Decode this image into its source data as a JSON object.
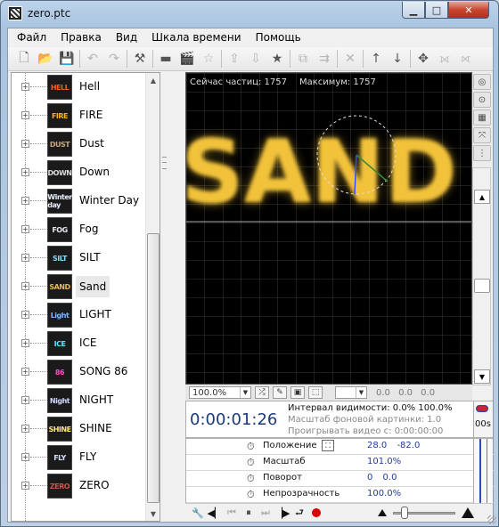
{
  "window": {
    "title": "zero.ptc",
    "min_glyph": "▁",
    "max_glyph": "□",
    "close_glyph": "✕"
  },
  "menu": [
    "Файл",
    "Правка",
    "Вид",
    "Шкала времени",
    "Помощь"
  ],
  "toolbar": [
    {
      "icon": "new-file-icon",
      "glyph": "🗋",
      "enabled": true
    },
    {
      "icon": "open-folder-icon",
      "glyph": "📂",
      "enabled": true
    },
    {
      "icon": "save-icon",
      "glyph": "💾",
      "enabled": false
    },
    {
      "sep": true
    },
    {
      "icon": "undo-icon",
      "glyph": "↶",
      "enabled": false
    },
    {
      "icon": "redo-icon",
      "glyph": "↷",
      "enabled": false
    },
    {
      "sep": true
    },
    {
      "icon": "wand-icon",
      "glyph": "⚒",
      "enabled": true
    },
    {
      "sep": true
    },
    {
      "icon": "folder-icon",
      "glyph": "▬",
      "enabled": true
    },
    {
      "icon": "clapper-icon",
      "glyph": "🎬",
      "enabled": true
    },
    {
      "icon": "star-icon",
      "glyph": "☆",
      "enabled": false
    },
    {
      "sep": true
    },
    {
      "icon": "export-icon",
      "glyph": "⇪",
      "enabled": false
    },
    {
      "icon": "import-icon",
      "glyph": "⇩",
      "enabled": false
    },
    {
      "icon": "add-star-icon",
      "glyph": "★",
      "enabled": true
    },
    {
      "sep": true
    },
    {
      "icon": "copy-icon",
      "glyph": "⧉",
      "enabled": false
    },
    {
      "icon": "move-icon",
      "glyph": "⇉",
      "enabled": false
    },
    {
      "sep": true
    },
    {
      "icon": "delete-icon",
      "glyph": "✕",
      "enabled": false
    },
    {
      "sep": true
    },
    {
      "icon": "arrow-up-icon",
      "glyph": "↑",
      "enabled": true
    },
    {
      "icon": "arrow-down-icon",
      "glyph": "↓",
      "enabled": true
    },
    {
      "sep": true
    },
    {
      "icon": "move-all-icon",
      "glyph": "✥",
      "enabled": true
    },
    {
      "icon": "link-icon",
      "glyph": "⟗",
      "enabled": false
    },
    {
      "icon": "unlink-icon",
      "glyph": "⟖",
      "enabled": false
    }
  ],
  "effects": [
    {
      "label": "Hell",
      "thumb": "HELL",
      "color": "#ff5a1a"
    },
    {
      "label": "FIRE",
      "thumb": "FIRE",
      "color": "#ffb020"
    },
    {
      "label": "Dust",
      "thumb": "DUST",
      "color": "#c8a878"
    },
    {
      "label": "Down",
      "thumb": "DOWN",
      "color": "#dddddd"
    },
    {
      "label": "Winter Day",
      "thumb": "Winter day",
      "color": "#e8f0ff"
    },
    {
      "label": "Fog",
      "thumb": "FOG",
      "color": "#e6e6f0"
    },
    {
      "label": "SILT",
      "thumb": "SILT",
      "color": "#7fd8ff"
    },
    {
      "label": "Sand",
      "thumb": "SAND",
      "color": "#e6b84a",
      "selected": true
    },
    {
      "label": "LIGHT",
      "thumb": "Light",
      "color": "#7ab8ff"
    },
    {
      "label": "ICE",
      "thumb": "ICE",
      "color": "#5fe3ff"
    },
    {
      "label": "SONG 86",
      "thumb": "86",
      "color": "#ff4ad8"
    },
    {
      "label": "NIGHT",
      "thumb": "Night",
      "color": "#d0d8ff"
    },
    {
      "label": "SHINE",
      "thumb": "SHINE",
      "color": "#ffe680"
    },
    {
      "label": "FLY",
      "thumb": "FLY",
      "color": "#cfe0ff"
    },
    {
      "label": "ZERO",
      "thumb": "ZERO",
      "color": "#c25a4a"
    }
  ],
  "viewport": {
    "particles_now_label": "Сейчас частиц: 1757",
    "particles_max_label": "Максимум: 1757",
    "text": "SAND",
    "text_color": "#f2c23a"
  },
  "right_tools": [
    {
      "icon": "headphones-icon",
      "glyph": "◎"
    },
    {
      "icon": "target-icon",
      "glyph": "⊙"
    },
    {
      "icon": "grid-icon",
      "glyph": "▦"
    },
    {
      "icon": "zoom-fit-icon",
      "glyph": "⤧"
    },
    {
      "icon": "guides-icon",
      "glyph": "⋮"
    }
  ],
  "controls": {
    "zoom": "100.0%",
    "color_combo": "",
    "xyz": "0.0   0.0   0.0"
  },
  "timeline": {
    "timecode": "0:00:01:26",
    "visibility_label": "Интервал видимости: 0.0%  100.0%",
    "bg_scale_label": "Масштаб фоновой картинки: 1.0",
    "play_video_label": "Проигрывать видео с: 0:00:00:00",
    "ruler_label": "00s"
  },
  "properties": [
    {
      "name": "Положение",
      "value": "28.0   -82.0",
      "linked": true
    },
    {
      "name": "Масштаб",
      "value": "101.0%"
    },
    {
      "name": "Поворот",
      "value": "0   0.0"
    },
    {
      "name": "Непрозрачность",
      "value": "100.0%"
    }
  ],
  "playback": {
    "settings_icon": "🔧",
    "prev_key": "◀▏",
    "to_start": "⏮",
    "pause": "⏸",
    "to_end": "⏭",
    "next_key": "▕▶",
    "loop": "⮐",
    "zoom_level": 0.15
  }
}
